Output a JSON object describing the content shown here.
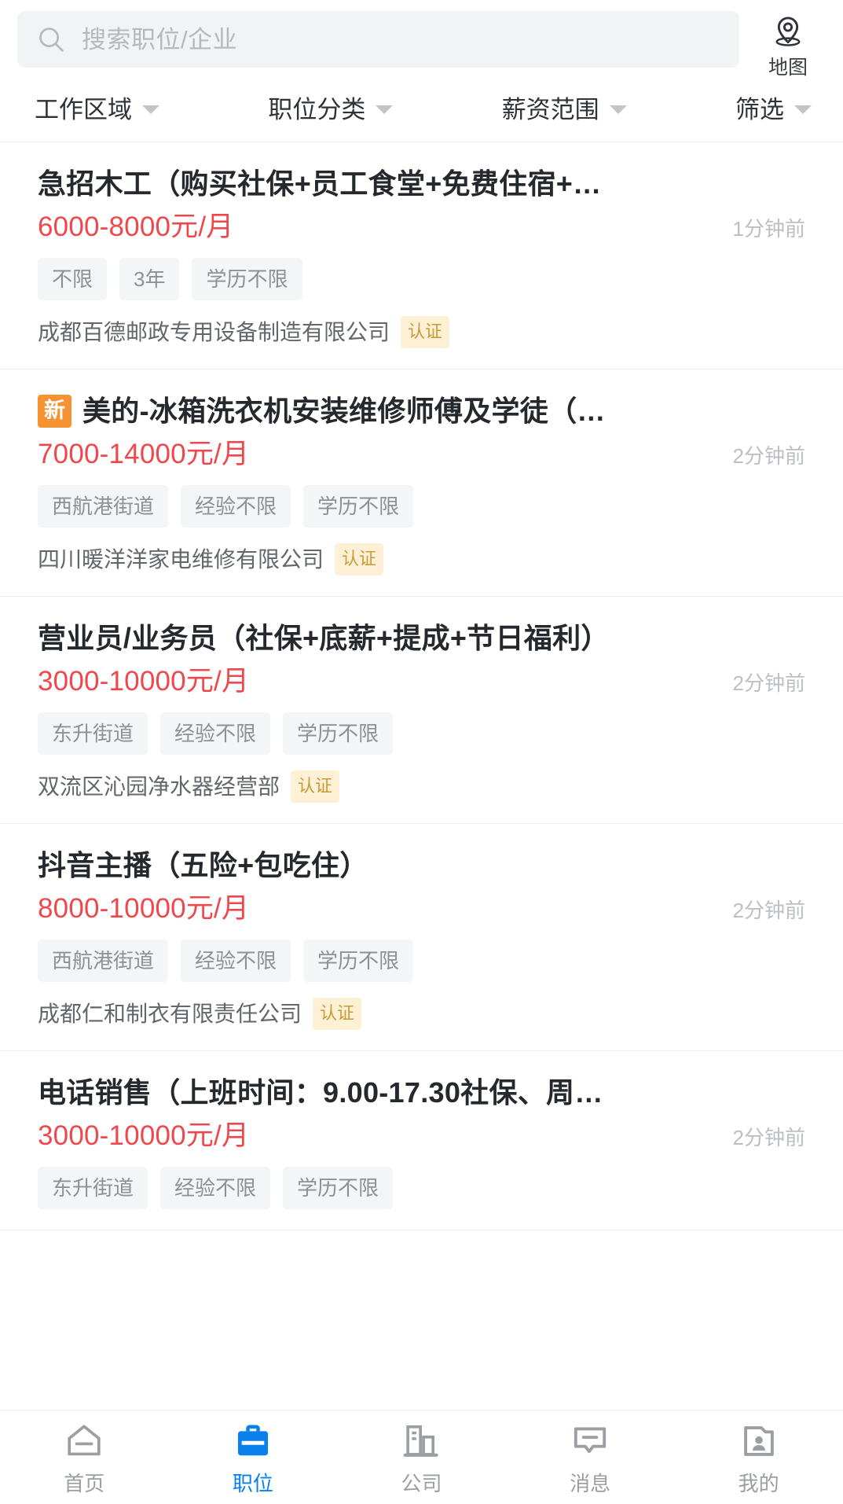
{
  "search": {
    "placeholder": "搜索职位/企业",
    "value": "",
    "icon": "search-icon"
  },
  "map_button": {
    "label": "地图",
    "icon": "map-pin-icon"
  },
  "filters": [
    {
      "label": "工作区域",
      "icon": "chevron-down-icon"
    },
    {
      "label": "职位分类",
      "icon": "chevron-down-icon"
    },
    {
      "label": "薪资范围",
      "icon": "chevron-down-icon"
    },
    {
      "label": "筛选",
      "icon": "chevron-down-icon"
    }
  ],
  "colors": {
    "salary": "#f0474c",
    "new_badge": "#f59232",
    "verified_bg": "#fdf0d4",
    "verified_text": "#c99a3a",
    "active_tab": "#0a80ed",
    "tag_bg": "#f4f5f6",
    "search_bg": "#f2f3f5"
  },
  "jobs": [
    {
      "badge": "",
      "title": "急招木工（购买社保+员工食堂+免费住宿+…",
      "salary": "6000-8000元/月",
      "time": "1分钟前",
      "tags": [
        "不限",
        "3年",
        "学历不限"
      ],
      "company": "成都百德邮政专用设备制造有限公司",
      "verified": "认证"
    },
    {
      "badge": "新",
      "title": "美的-冰箱洗衣机安装维修师傅及学徒（…",
      "salary": "7000-14000元/月",
      "time": "2分钟前",
      "tags": [
        "西航港街道",
        "经验不限",
        "学历不限"
      ],
      "company": "四川暖洋洋家电维修有限公司",
      "verified": "认证"
    },
    {
      "badge": "",
      "title": "营业员/业务员（社保+底薪+提成+节日福利）",
      "salary": "3000-10000元/月",
      "time": "2分钟前",
      "tags": [
        "东升街道",
        "经验不限",
        "学历不限"
      ],
      "company": "双流区沁园净水器经营部",
      "verified": "认证"
    },
    {
      "badge": "",
      "title": "抖音主播（五险+包吃住）",
      "salary": "8000-10000元/月",
      "time": "2分钟前",
      "tags": [
        "西航港街道",
        "经验不限",
        "学历不限"
      ],
      "company": "成都仁和制衣有限责任公司",
      "verified": "认证"
    },
    {
      "badge": "",
      "title": "电话销售（上班时间：9.00-17.30社保、周…",
      "salary": "3000-10000元/月",
      "time": "2分钟前",
      "tags": [
        "东升街道",
        "经验不限",
        "学历不限"
      ],
      "company": "",
      "verified": ""
    }
  ],
  "tabbar": [
    {
      "label": "首页",
      "icon": "home-icon",
      "active": false
    },
    {
      "label": "职位",
      "icon": "briefcase-icon",
      "active": true
    },
    {
      "label": "公司",
      "icon": "building-icon",
      "active": false
    },
    {
      "label": "消息",
      "icon": "message-icon",
      "active": false
    },
    {
      "label": "我的",
      "icon": "profile-icon",
      "active": false
    }
  ]
}
